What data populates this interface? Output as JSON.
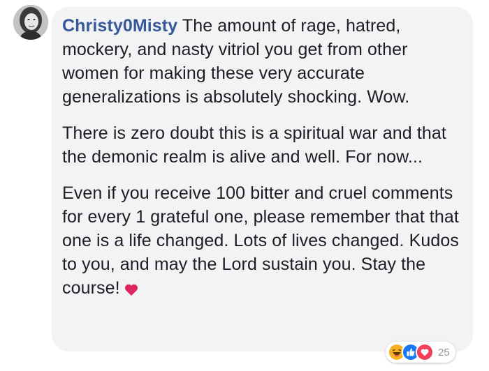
{
  "comment": {
    "author": "Christy0Misty",
    "paragraphs": [
      "The amount of rage, hatred, mockery, and nasty vitriol you get from other women for making these very accurate generalizations is absolutely shocking. Wow.",
      "There is zero doubt this is a spiritual war and that the demonic realm is alive and well. For now...",
      "Even if you receive 100 bitter and cruel comments for every 1 grateful one, please remember that that one is a life changed. Lots of lives changed. Kudos to you, and may the Lord sustain you. Stay the course!"
    ],
    "trailing_icon": "heart-icon"
  },
  "reactions": {
    "icons": [
      "haha-icon",
      "like-icon",
      "love-icon"
    ],
    "count": "25"
  },
  "colors": {
    "author": "#385898",
    "bubble": "#f2f3f5",
    "text": "#1c1e21",
    "like": "#1877f2",
    "love": "#f33e58",
    "haha": "#f7b125"
  }
}
